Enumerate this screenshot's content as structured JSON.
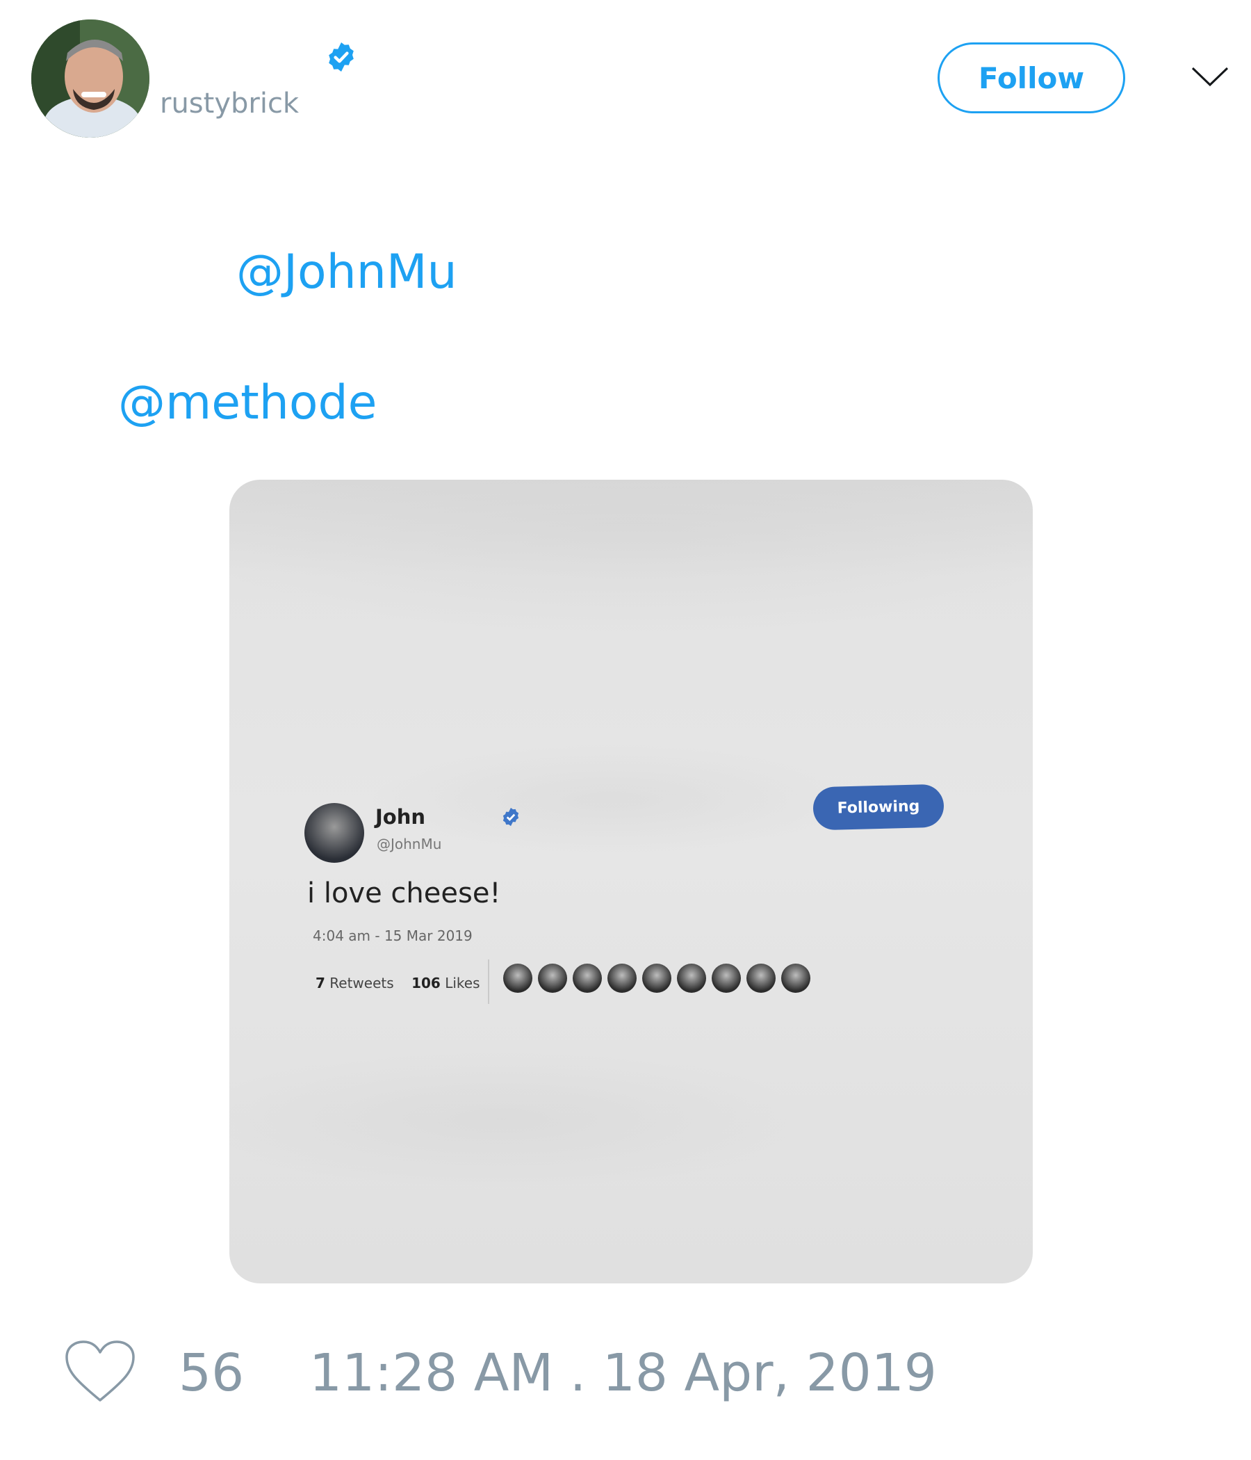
{
  "author": {
    "handle": "rustybrick",
    "verified": true,
    "avatar_icon": "avatar-photo"
  },
  "actions": {
    "follow_label": "Follow",
    "more_icon": "chevron-down-icon"
  },
  "mentions": [
    "@JohnMu",
    "@methode"
  ],
  "media": {
    "embedded_tweet": {
      "name": "John",
      "handle": "@JohnMu",
      "following_label": "Following",
      "text": "i love cheese!",
      "time": "4:04 am - 15 Mar 2019",
      "retweets_count": "7",
      "retweets_label": "Retweets",
      "likes_count": "106",
      "likes_label": "Likes"
    }
  },
  "footer": {
    "like_icon": "heart-icon",
    "likes": "56",
    "timestamp": "11:28 AM . 18 Apr, 2019"
  },
  "colors": {
    "accent": "#1da1f2",
    "muted": "#8899a6",
    "shirt_button": "#3a66b3"
  }
}
